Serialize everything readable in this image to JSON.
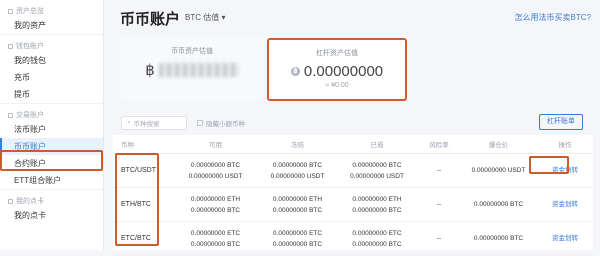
{
  "sidebar": {
    "sections": [
      {
        "title": "资产总览",
        "items": [
          "我的资产"
        ]
      },
      {
        "title": "钱包账户",
        "items": [
          "我的钱包",
          "充币",
          "提币"
        ]
      },
      {
        "title": "交易账户",
        "items": [
          "法币账户",
          "币币账户",
          "合约账户",
          "ETT组合账户"
        ]
      },
      {
        "title": "我的点卡",
        "items": [
          "我的点卡"
        ]
      }
    ],
    "active": "币币账户"
  },
  "header": {
    "title": "币币账户",
    "currency": "BTC 估值 ▾",
    "help_link": "怎么用法币买卖BTC?"
  },
  "cards": {
    "spot": {
      "label": "币币资产估值",
      "symbol": "฿"
    },
    "margin": {
      "label": "杠杆资产估值",
      "symbol": "฿",
      "value": "0.00000000",
      "sub": "≈ ¥0.00"
    }
  },
  "filters": {
    "search_placeholder": "币种搜索",
    "hide_small": "隐藏小额币种",
    "leverage_button": "杠杆账单"
  },
  "table": {
    "headers": [
      "币种",
      "可用",
      "冻结",
      "已借",
      "风险率",
      "爆仓价",
      "操作"
    ],
    "rows": [
      {
        "pair": "BTC/USDT",
        "available": [
          "0.00000000 BTC",
          "0.00000000 USDT"
        ],
        "frozen": [
          "0.00000000 BTC",
          "0.00000000 USDT"
        ],
        "borrowed": [
          "0.00000000 BTC",
          "0.00000000 USDT"
        ],
        "risk": "--",
        "liq": "0.00000000 USDT",
        "action": "资金划转"
      },
      {
        "pair": "ETH/BTC",
        "available": [
          "0.00000000 ETH",
          "0.00000000 BTC"
        ],
        "frozen": [
          "0.00000000 ETH",
          "0.00000000 BTC"
        ],
        "borrowed": [
          "0.00000000 ETH",
          "0.00000000 BTC"
        ],
        "risk": "--",
        "liq": "0.00000000 BTC",
        "action": "资金划转"
      },
      {
        "pair": "ETC/BTC",
        "available": [
          "0.00000000 ETC",
          "0.00000000 BTC"
        ],
        "frozen": [
          "0.00000000 ETC",
          "0.00000000 BTC"
        ],
        "borrowed": [
          "0.00000000 ETC",
          "0.00000000 BTC"
        ],
        "risk": "--",
        "liq": "0.00000000 BTC",
        "action": "资金划转"
      }
    ]
  },
  "colors": {
    "accent": "#3a7bd5",
    "highlight": "#cf5a2e"
  }
}
